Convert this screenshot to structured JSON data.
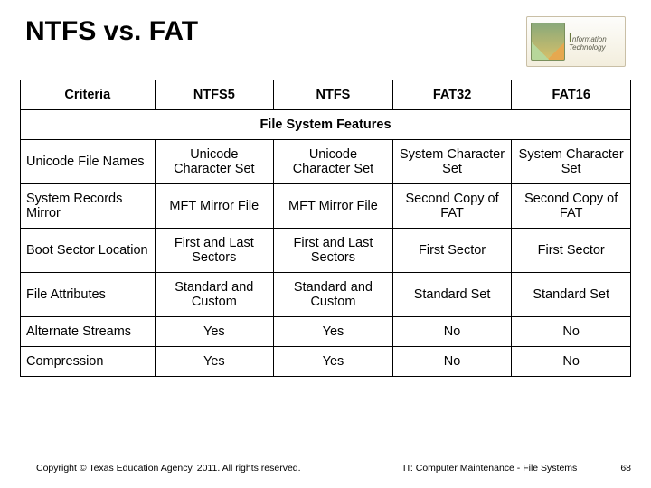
{
  "title": "NTFS vs. FAT",
  "logo": {
    "line1": "nformation",
    "line2": "Technology"
  },
  "table": {
    "headers": [
      "Criteria",
      "NTFS5",
      "NTFS",
      "FAT32",
      "FAT16"
    ],
    "section_header": "File System Features",
    "rows": [
      {
        "criteria": "Unicode File Names",
        "c1": "Unicode Character Set",
        "c2": "Unicode Character Set",
        "c3": "System Character Set",
        "c4": "System Character Set"
      },
      {
        "criteria": "System Records Mirror",
        "c1": "MFT Mirror File",
        "c2": "MFT Mirror File",
        "c3": "Second Copy of  FAT",
        "c4": "Second Copy of  FAT"
      },
      {
        "criteria": "Boot Sector Location",
        "c1": "First and Last Sectors",
        "c2": "First and Last Sectors",
        "c3": "First Sector",
        "c4": "First Sector"
      },
      {
        "criteria": "File Attributes",
        "c1": "Standard and Custom",
        "c2": "Standard and Custom",
        "c3": "Standard Set",
        "c4": "Standard Set"
      },
      {
        "criteria": "Alternate Streams",
        "c1": "Yes",
        "c2": "Yes",
        "c3": "No",
        "c4": "No"
      },
      {
        "criteria": "Compression",
        "c1": "Yes",
        "c2": "Yes",
        "c3": "No",
        "c4": "No"
      }
    ]
  },
  "footer": {
    "copyright": "Copyright © Texas Education Agency, 2011. All rights reserved.",
    "course": "IT: Computer Maintenance - File Systems",
    "page": "68"
  }
}
